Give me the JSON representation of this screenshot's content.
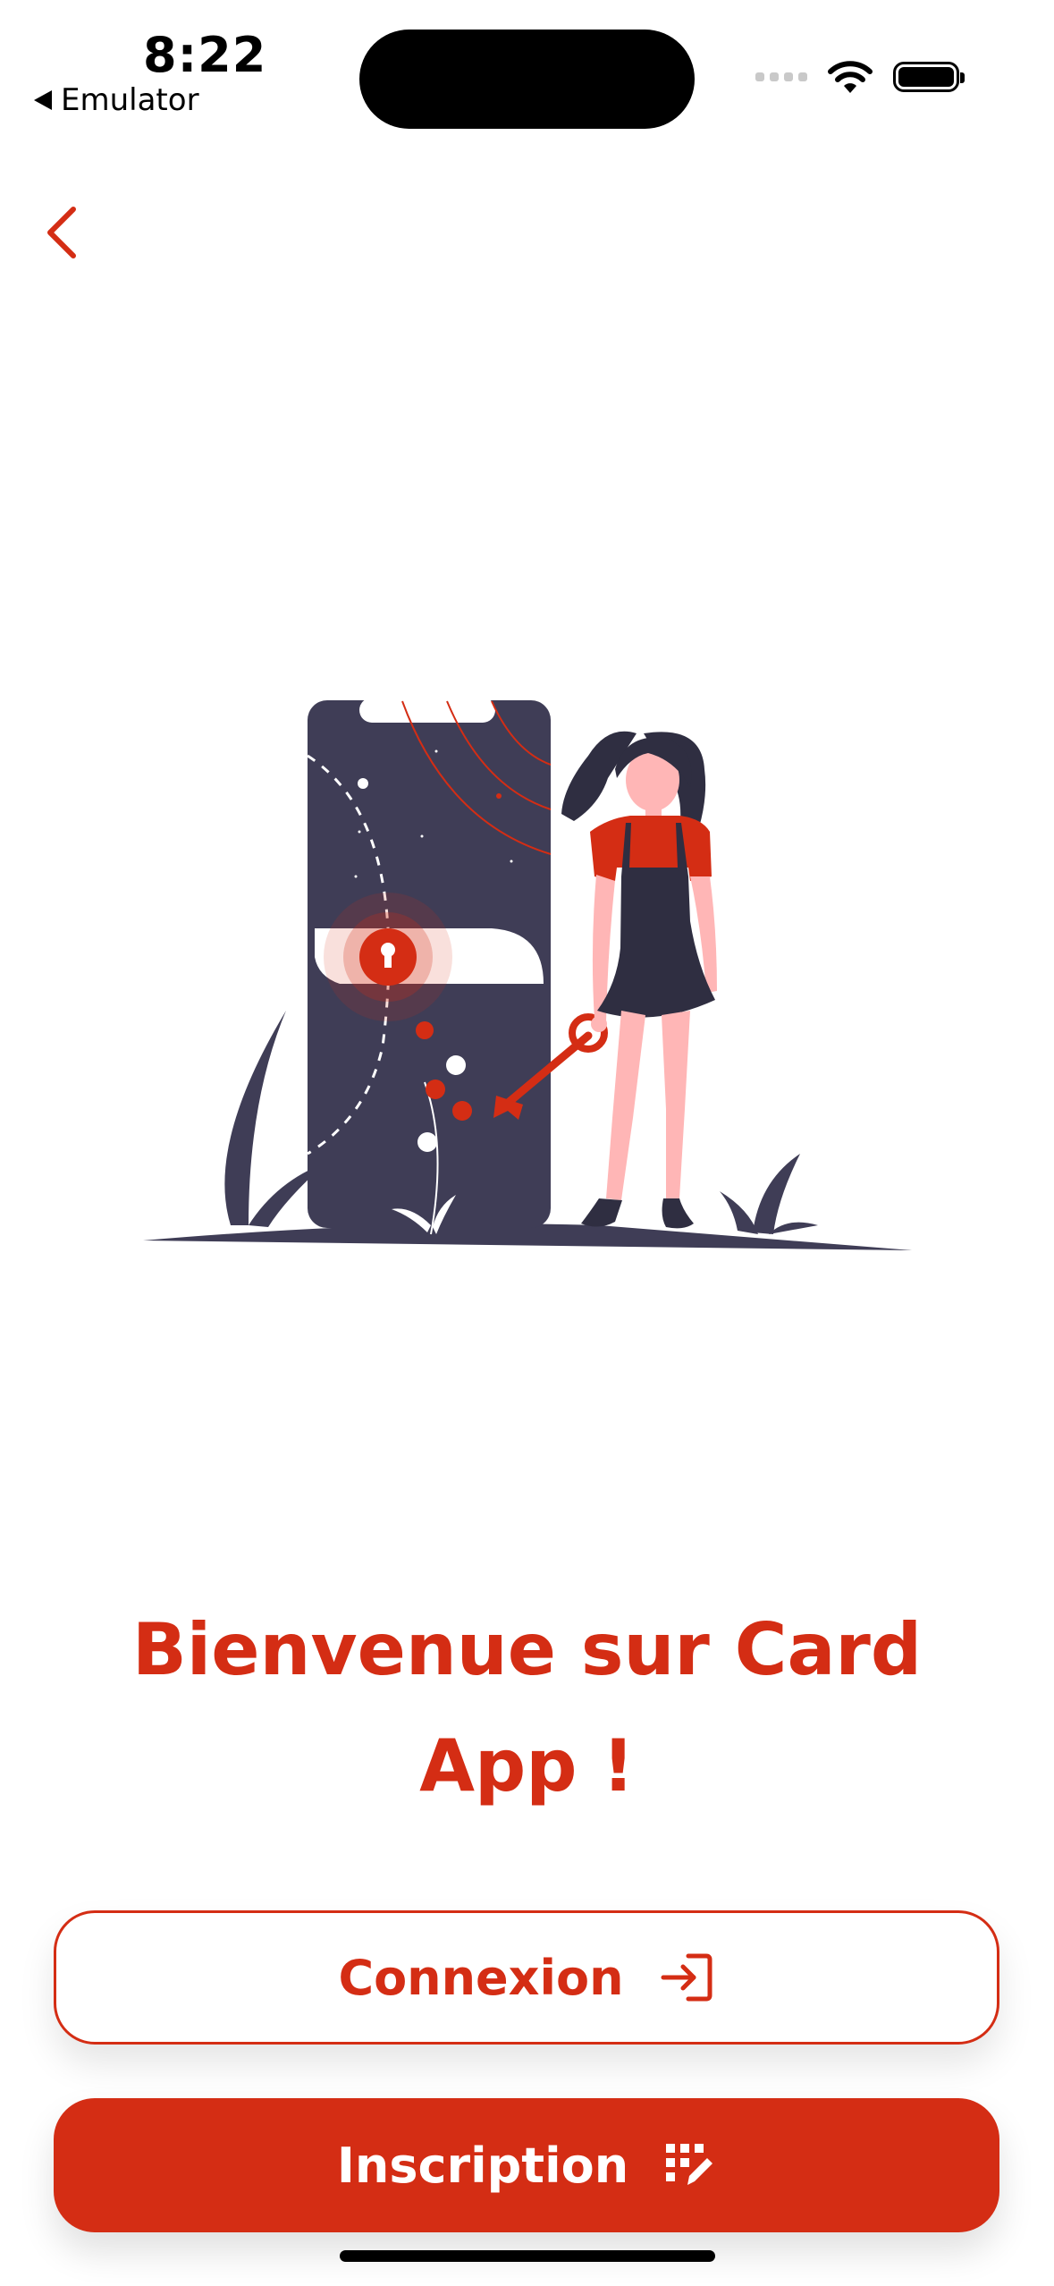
{
  "status_bar": {
    "time": "8:22",
    "back_app_label": "Emulator"
  },
  "nav": {
    "back_icon": "chevron-left-icon"
  },
  "welcome": {
    "title": "Bienvenue sur Card App !"
  },
  "actions": {
    "login_label": "Connexion",
    "login_icon": "login-arrow-icon",
    "signup_label": "Inscription",
    "signup_icon": "signup-form-icon"
  },
  "colors": {
    "accent": "#d42d14",
    "illustration_dark": "#3f3d56",
    "skin": "#ffb6b6",
    "background": "#ffffff"
  }
}
